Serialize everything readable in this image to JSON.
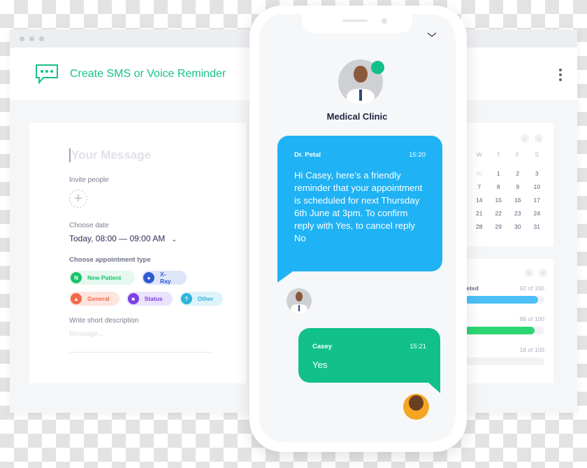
{
  "app": {
    "title": "Create SMS or Voice Reminder",
    "icon": "chat-bubble-icon"
  },
  "form": {
    "message_placeholder": "Your Message",
    "invite_label": "Invite people",
    "date_label": "Choose date",
    "date_value": "Today, 08:00 — 09:00 AM",
    "type_label": "Choose appointment type",
    "types": [
      {
        "label": "New Patient",
        "color": "#19c26a"
      },
      {
        "label": "X-Ray",
        "color": "#2f5ad1"
      },
      {
        "label": "General",
        "color": "#f46a4a"
      },
      {
        "label": "Status",
        "color": "#7b3fe4"
      },
      {
        "label": "Other",
        "color": "#2fb3d9"
      }
    ],
    "desc_label": "Write short description",
    "desc_placeholder": "Message..."
  },
  "calendar": {
    "days": [
      "W",
      "T",
      "F",
      "S"
    ],
    "rows": [
      [
        "30",
        "1",
        "2",
        "3"
      ],
      [
        "7",
        "8",
        "9",
        "10"
      ],
      [
        "14",
        "15",
        "16",
        "17"
      ],
      [
        "21",
        "22",
        "23",
        "24"
      ],
      [
        "28",
        "29",
        "30",
        "31"
      ]
    ]
  },
  "progress": {
    "partial_label": "leted",
    "items": [
      {
        "text": "92 of 100",
        "value": 92,
        "color": "#4cc0f7"
      },
      {
        "text": "88 of 100",
        "value": 88,
        "color": "#2ed573"
      },
      {
        "text": "18 of 100",
        "value": 18,
        "color": "#f2f3f5"
      }
    ]
  },
  "phone": {
    "contact": "Medical Clinic",
    "status_color": "#12c08a",
    "messages": [
      {
        "sender": "Dr. Petal",
        "time": "15:20",
        "text": "Hi Casey, here’s a friendly reminder that your appointment is scheduled for next Thursday 6th June at 3pm. To confirm reply with Yes, to cancel reply No"
      },
      {
        "sender": "Casey",
        "time": "15:21",
        "text": "Yes"
      }
    ]
  }
}
